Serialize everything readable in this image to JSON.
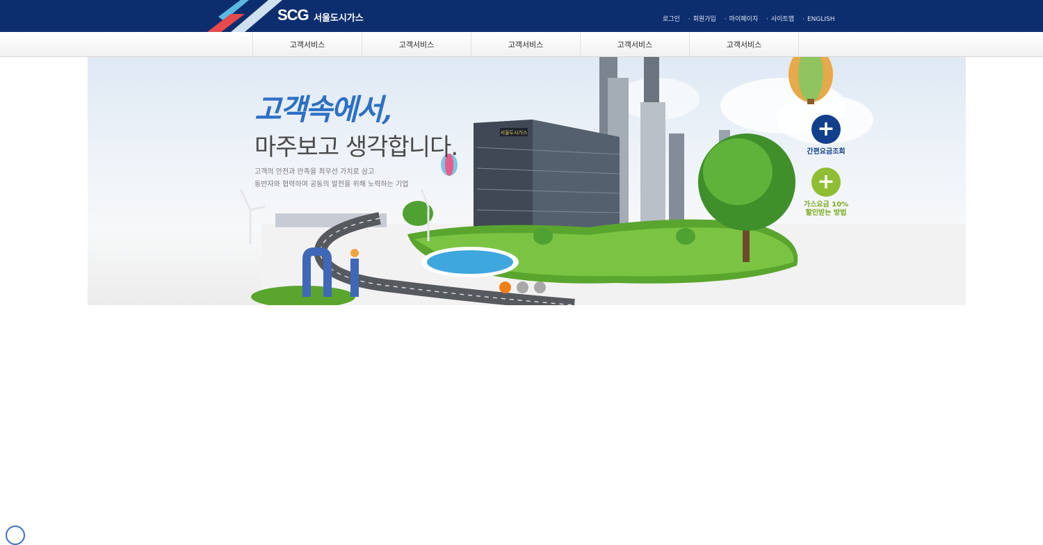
{
  "brand": {
    "name": "SCG",
    "name_ko": "서울도시가스"
  },
  "util_links": [
    "로그인",
    "회원가입",
    "마이페이지",
    "사이트맵",
    "ENGLISH"
  ],
  "nav": [
    "고객서비스",
    "고객서비스",
    "고객서비스",
    "고객서비스",
    "고객서비스"
  ],
  "hero": {
    "headline1": "고객속에서,",
    "headline2": "마주보고 생각합니다.",
    "desc1": "고객의 안전과 만족을 최우선 가치로 삼고",
    "desc2": "동반자와 협력하여 공동의 발전을 위해 노력하는 기업",
    "building_sign": "서울도시가스"
  },
  "quick_buttons": [
    {
      "icon": "plus-icon",
      "label1": "간편요금조회",
      "label2": "",
      "color": "#123f8c"
    },
    {
      "icon": "plus-icon",
      "label1": "가스요금 10%",
      "label2": "할인받는 방법",
      "color": "#8fbe33"
    }
  ],
  "slider": {
    "count": 3,
    "active": 0,
    "active_color": "#f07f17"
  },
  "colors": {
    "header": "#0d2e6e",
    "accent_blue": "#2c6fc6"
  }
}
